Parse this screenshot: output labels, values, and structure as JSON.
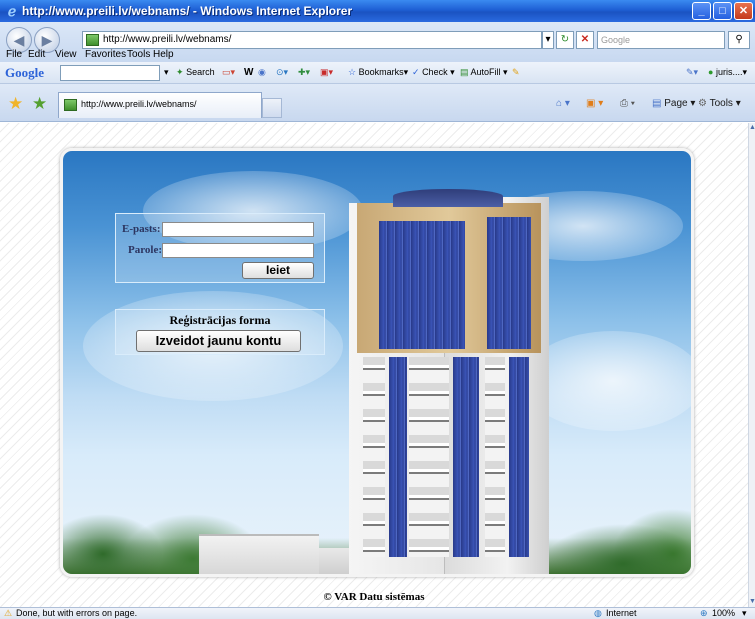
{
  "window": {
    "title": "http://www.preili.lv/webnams/ - Windows Internet Explorer",
    "minimize": "_",
    "maximize": "□",
    "close": "✕"
  },
  "address_bar": {
    "url": "http://www.preili.lv/webnams/",
    "search_placeholder": "Google",
    "back_glyph": "◀",
    "forward_glyph": "▶",
    "refresh_glyph": "↻",
    "stop_glyph": "✕",
    "search_glyph": "⚲"
  },
  "menu": {
    "items": [
      "File",
      "Edit",
      "View",
      "Favorites",
      "Tools",
      "Help"
    ]
  },
  "google_toolbar": {
    "logo": "Google",
    "search": "Search",
    "bookmarks": "Bookmarks",
    "check": "Check",
    "autofill": "AutoFill",
    "user": "juris...."
  },
  "tab_bar": {
    "tab_title": "http://www.preili.lv/webnams/",
    "page": "Page",
    "tools": "Tools"
  },
  "login": {
    "email_label": "E-pasts:",
    "email_value": "",
    "password_label": "Parole:",
    "password_value": "",
    "login_button": "Ieiet"
  },
  "registration": {
    "title": "Reģistrācijas forma",
    "button": "Izveidot jaunu kontu"
  },
  "footer": {
    "text": "© VAR Datu sistēmas"
  },
  "status_bar": {
    "message": "Done, but with errors on page.",
    "zone": "Internet",
    "zoom": "100%"
  },
  "colors": {
    "title_bar": "#1e5fd4",
    "sky_top": "#2a77c2",
    "facade_glass": "#2b3f96",
    "facade_cap": "#c8a875"
  }
}
